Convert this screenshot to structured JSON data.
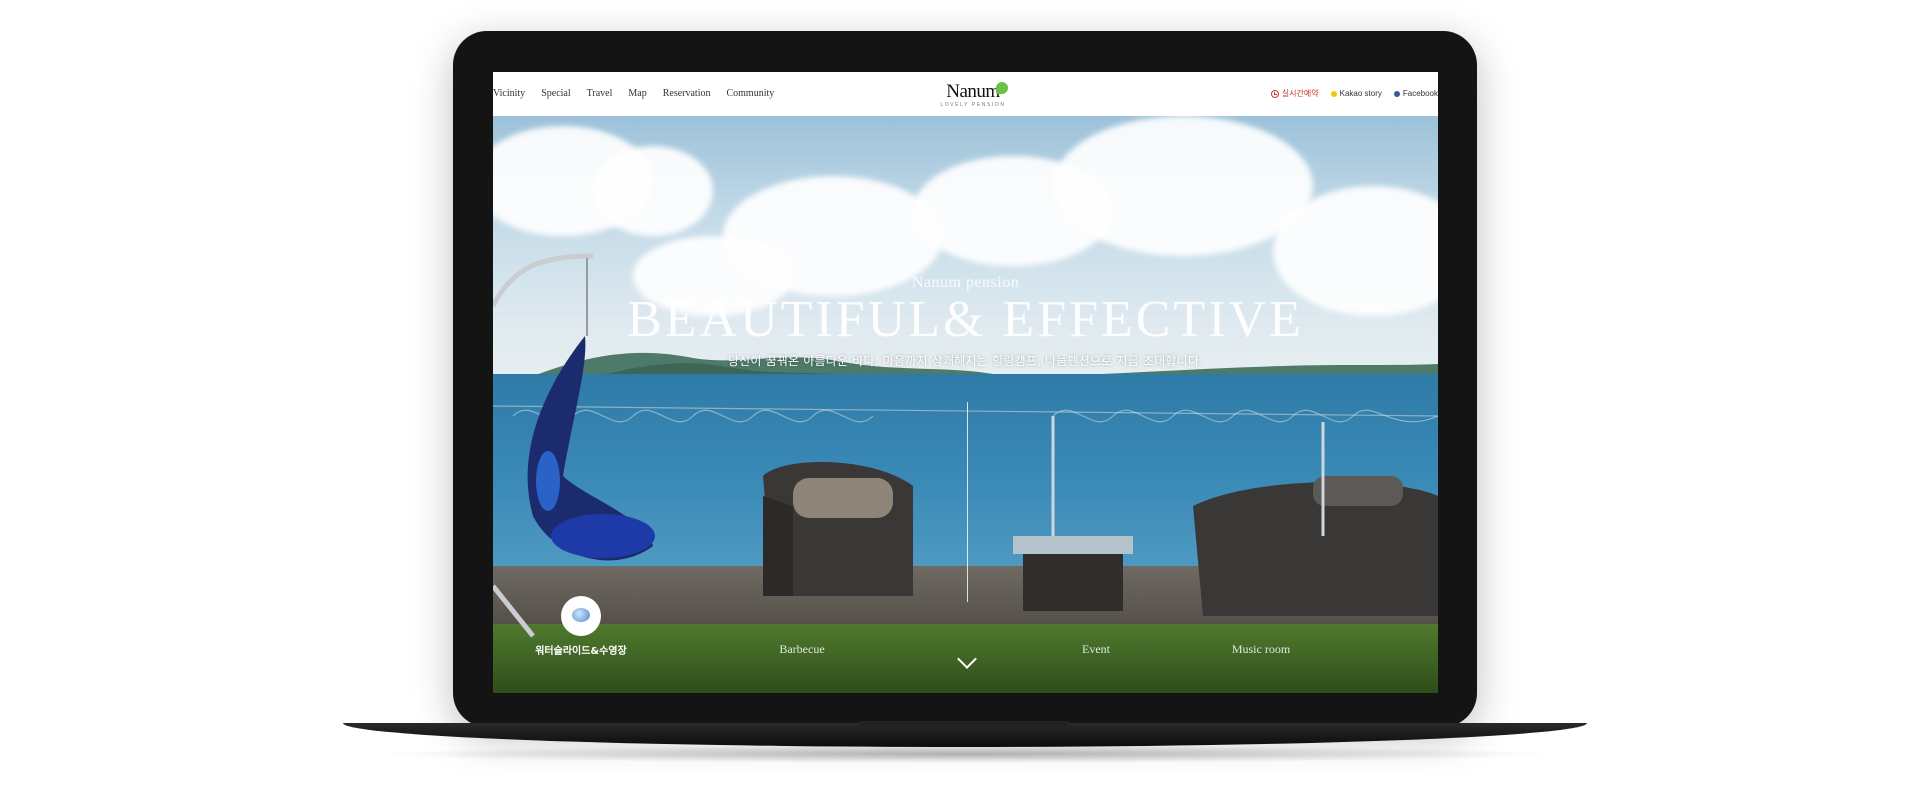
{
  "header": {
    "nav": [
      "Vicinity",
      "Special",
      "Travel",
      "Map",
      "Reservation",
      "Community"
    ],
    "logo_word": "Nanum",
    "logo_sub": "LOVELY PENSION",
    "social": {
      "live_reservation": "실시간예약",
      "kakao": "Kakao story",
      "facebook": "Facebook"
    }
  },
  "hero": {
    "subtitle": "Nanum pension",
    "title": "BEAUTIFUL& EFFECTIVE",
    "description": "당신이 꿈꿔온 아름다운 바다, 마음까지 상쾌해지는 힐링캠프, 나눔펜션으로 지금 초대합니다."
  },
  "features": [
    {
      "label": "워터슬라이드&수영장",
      "active": true
    },
    {
      "label": "Barbecue",
      "active": false
    },
    {
      "label": "Event",
      "active": false
    },
    {
      "label": "Music room",
      "active": false
    }
  ],
  "icons": {
    "scroll": "chevron-down-icon",
    "live": "clock-icon",
    "kakao": "kakao-icon",
    "facebook": "facebook-icon"
  },
  "colors": {
    "accent_live": "#c0392b",
    "leaf": "#6cc04a",
    "kakao": "#f7c800",
    "facebook": "#3b5998"
  }
}
